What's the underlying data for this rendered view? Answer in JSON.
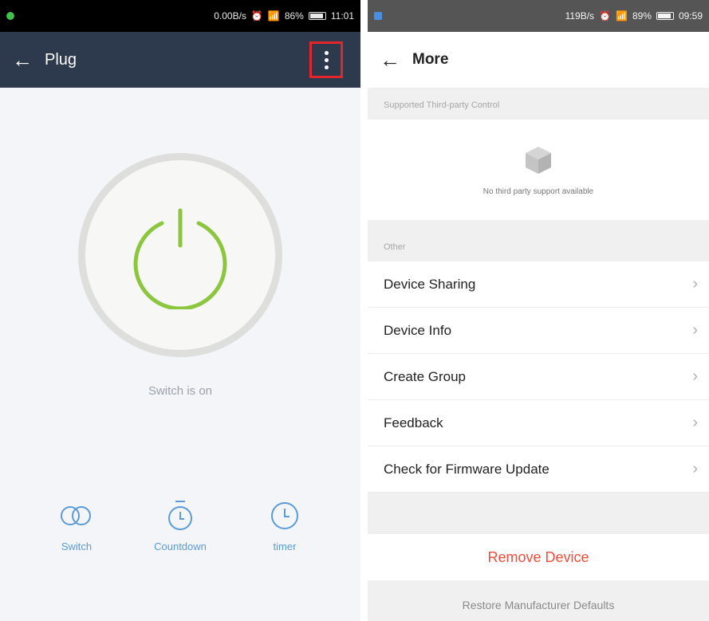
{
  "left_screen": {
    "status_bar": {
      "speed": "0.00B/s",
      "battery": "86%",
      "time": "11:01",
      "indicator_color": "#3ec24a"
    },
    "header": {
      "title": "Plug"
    },
    "status_text": "Switch is on",
    "controls": [
      {
        "label": "Switch",
        "icon": "toggle-icon"
      },
      {
        "label": "Countdown",
        "icon": "stopwatch-icon"
      },
      {
        "label": "timer",
        "icon": "clock-icon"
      }
    ],
    "colors": {
      "header_bg": "#2d3a4e",
      "power_green": "#8cc63f",
      "highlight_red": "#e2262b",
      "control_blue": "#5b9bd8"
    }
  },
  "right_screen": {
    "status_bar": {
      "speed": "119B/s",
      "battery": "89%",
      "time": "09:59"
    },
    "header": {
      "title": "More"
    },
    "third_party": {
      "section_label": "Supported Third-party Control",
      "empty_message": "No third party support available"
    },
    "other": {
      "section_label": "Other",
      "items": [
        {
          "label": "Device Sharing"
        },
        {
          "label": "Device Info"
        },
        {
          "label": "Create Group"
        },
        {
          "label": "Feedback"
        },
        {
          "label": "Check for Firmware Update"
        }
      ]
    },
    "remove_label": "Remove Device",
    "restore_label": "Restore Manufacturer Defaults",
    "colors": {
      "remove_red": "#f04d3c"
    }
  }
}
